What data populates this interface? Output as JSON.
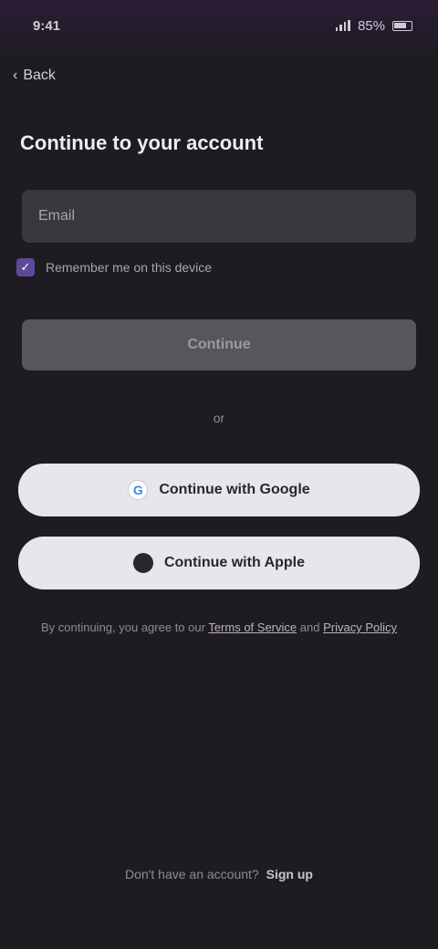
{
  "status_bar": {
    "time": "9:41",
    "battery": "85%"
  },
  "nav": {
    "back_label": "Back"
  },
  "page": {
    "title": "Continue to your account"
  },
  "email_field": {
    "placeholder": "Email"
  },
  "remember": {
    "label": "Remember me on this device"
  },
  "primary_button": {
    "label": "Continue"
  },
  "divider": {
    "label": "or"
  },
  "social": {
    "google_label": "Continue with Google",
    "apple_label": "Continue with Apple"
  },
  "terms": {
    "prefix": "By continuing, you agree to our",
    "terms_link": "Terms of Service",
    "and": "and",
    "privacy_link": "Privacy Policy"
  },
  "footer": {
    "prompt": "Don't have an account?",
    "link": "Sign up"
  },
  "colors": {
    "background": "#1f1c21",
    "accent": "#5b4a9a",
    "button_light": "#e8e6ea"
  }
}
